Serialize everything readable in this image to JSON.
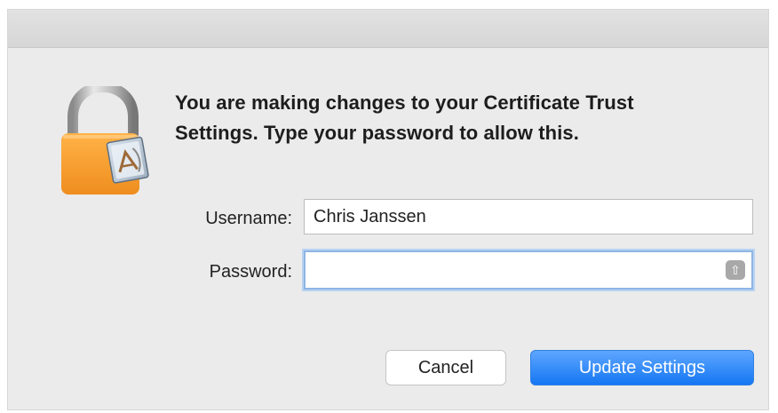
{
  "dialog": {
    "message_line_1": "You are making changes to your Certificate Trust",
    "message_line_2": "Settings. Type your password to allow this.",
    "username_label": "Username:",
    "username_value": "Chris Janssen",
    "password_label": "Password:",
    "password_value": "",
    "cancel_label": "Cancel",
    "update_label": "Update Settings",
    "icons": {
      "lock": "lock-icon",
      "keychain": "keychain-icon"
    }
  }
}
